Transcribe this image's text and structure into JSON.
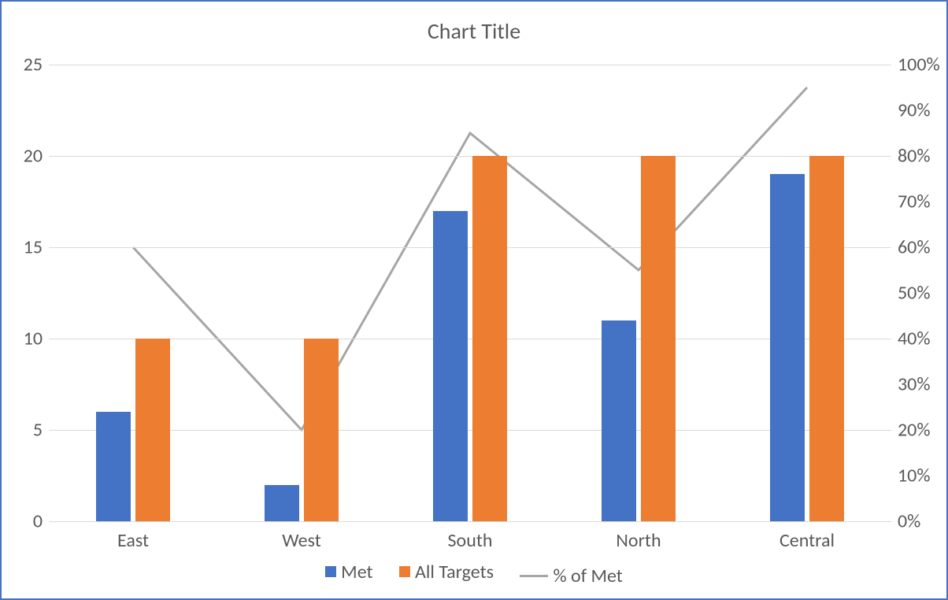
{
  "title": "Chart Title",
  "legend": {
    "met": "Met",
    "all": "All Targets",
    "pct": "% of Met"
  },
  "axis_left": {
    "min": 0,
    "max": 25,
    "ticks": [
      0,
      5,
      10,
      15,
      20,
      25
    ],
    "labels": [
      "0",
      "5",
      "10",
      "15",
      "20",
      "25"
    ]
  },
  "axis_right": {
    "min": 0,
    "max": 100,
    "ticks": [
      0,
      10,
      20,
      30,
      40,
      50,
      60,
      70,
      80,
      90,
      100
    ],
    "labels": [
      "0%",
      "10%",
      "20%",
      "30%",
      "40%",
      "50%",
      "60%",
      "70%",
      "80%",
      "90%",
      "100%"
    ]
  },
  "colors": {
    "met": "#4472C4",
    "all": "#ED7D31",
    "pct": "#A6A6A6",
    "grid": "#D9D9D9"
  },
  "chart_data": {
    "type": "bar",
    "categories": [
      "East",
      "West",
      "South",
      "North",
      "Central"
    ],
    "series": [
      {
        "name": "Met",
        "axis": "left",
        "kind": "bar",
        "values": [
          6,
          2,
          17,
          11,
          19
        ]
      },
      {
        "name": "All Targets",
        "axis": "left",
        "kind": "bar",
        "values": [
          10,
          10,
          20,
          20,
          20
        ]
      },
      {
        "name": "% of Met",
        "axis": "right",
        "kind": "line",
        "values": [
          60,
          20,
          85,
          55,
          95
        ]
      }
    ],
    "title": "Chart Title",
    "xlabel": "",
    "ylabel_left": "",
    "ylabel_right": "",
    "ylim_left": [
      0,
      25
    ],
    "ylim_right": [
      0,
      100
    ]
  }
}
